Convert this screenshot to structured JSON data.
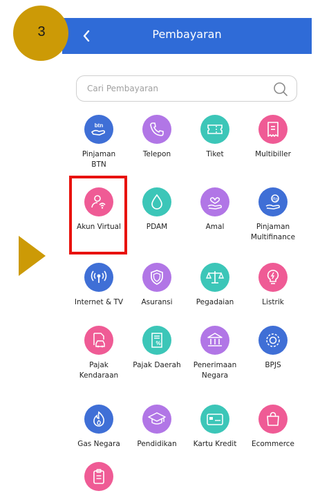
{
  "step_badge": "3",
  "header": {
    "title": "Pembayaran"
  },
  "search": {
    "placeholder": "Cari Pembayaran"
  },
  "colors": {
    "header_blue": "#2f6bd7",
    "badge_gold": "#cc9a06",
    "highlight_red": "#e8120c"
  },
  "services": [
    {
      "label": "Pinjaman\nBTN",
      "icon": "btn-hand-icon",
      "color": "#3f6fd6"
    },
    {
      "label": "Telepon",
      "icon": "phone-icon",
      "color": "#b176e6"
    },
    {
      "label": "Tiket",
      "icon": "ticket-icon",
      "color": "#3cc6b8"
    },
    {
      "label": "Multibiller",
      "icon": "receipt-icon",
      "color": "#ef5b95"
    },
    {
      "label": "Akun Virtual",
      "icon": "user-wifi-icon",
      "color": "#ef5b95"
    },
    {
      "label": "PDAM",
      "icon": "water-drop-icon",
      "color": "#3cc6b8"
    },
    {
      "label": "Amal",
      "icon": "heart-hand-icon",
      "color": "#b176e6"
    },
    {
      "label": "Pinjaman\nMultifinance",
      "icon": "coin-hand-icon",
      "color": "#3f6fd6"
    },
    {
      "label": "Internet & TV",
      "icon": "broadcast-icon",
      "color": "#3f6fd6"
    },
    {
      "label": "Asuransi",
      "icon": "shield-icon",
      "color": "#b176e6"
    },
    {
      "label": "Pegadaian",
      "icon": "scale-icon",
      "color": "#3cc6b8"
    },
    {
      "label": "Listrik",
      "icon": "lightbulb-icon",
      "color": "#ef5b95"
    },
    {
      "label": "Pajak\nKendaraan",
      "icon": "car-doc-icon",
      "color": "#ef5b95"
    },
    {
      "label": "Pajak Daerah",
      "icon": "percent-doc-icon",
      "color": "#3cc6b8"
    },
    {
      "label": "Penerimaan\nNegara",
      "icon": "government-icon",
      "color": "#b176e6"
    },
    {
      "label": "BPJS",
      "icon": "shield-badge-icon",
      "color": "#3f6fd6"
    },
    {
      "label": "Gas Negara",
      "icon": "flame-icon",
      "color": "#3f6fd6"
    },
    {
      "label": "Pendidikan",
      "icon": "graduation-cap-icon",
      "color": "#b176e6"
    },
    {
      "label": "Kartu Kredit",
      "icon": "credit-card-icon",
      "color": "#3cc6b8"
    },
    {
      "label": "Ecommerce",
      "icon": "shopping-bag-icon",
      "color": "#ef5b95"
    },
    {
      "label": "",
      "icon": "clipboard-icon",
      "color": "#ef5b95"
    }
  ]
}
